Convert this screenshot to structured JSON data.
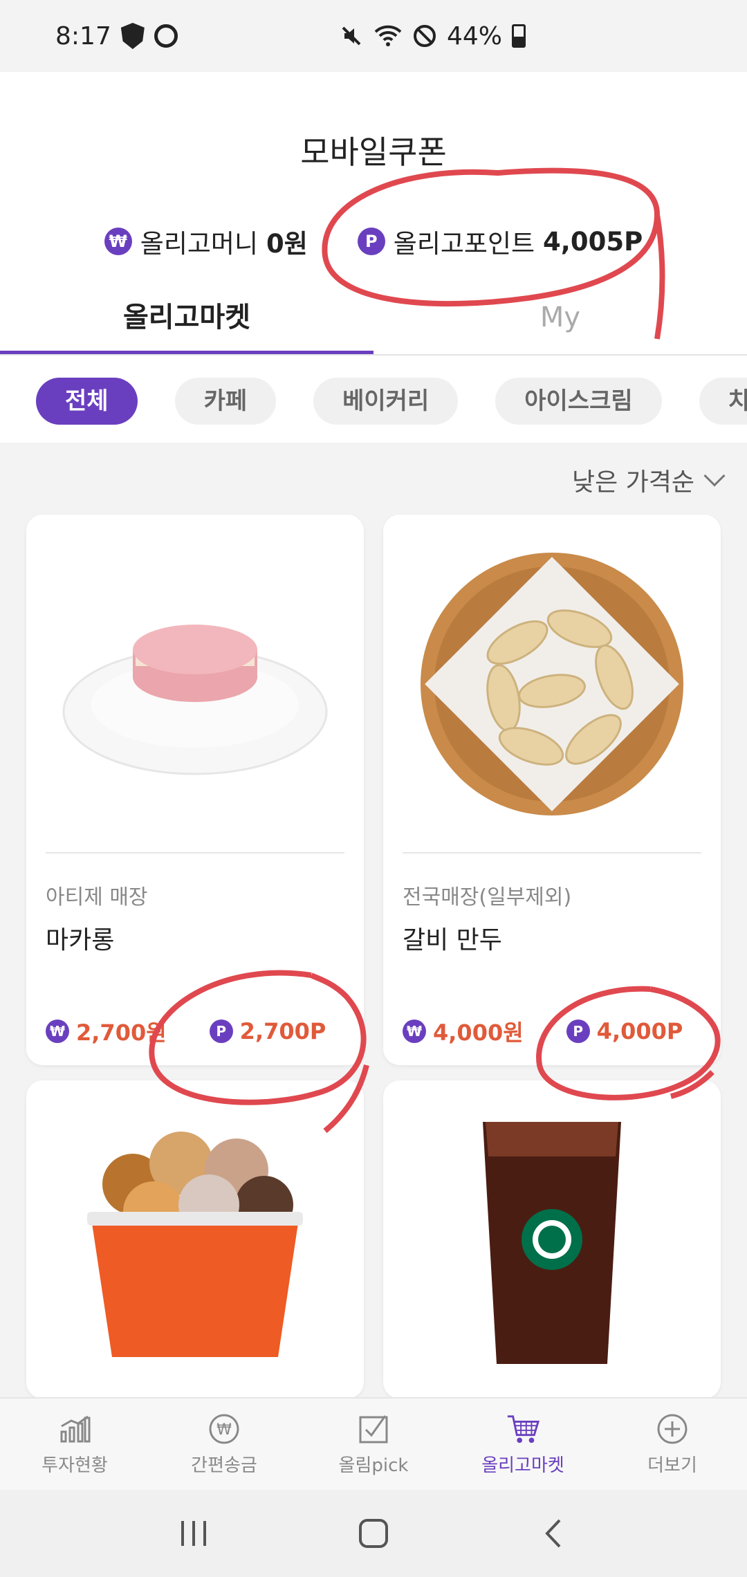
{
  "status_bar": {
    "time": "8:17",
    "battery": "44%"
  },
  "header": {
    "title": "모바일쿠폰",
    "money_label": "올리고머니",
    "money_value": "0원",
    "point_label": "올리고포인트",
    "point_value": "4,005P",
    "money_coin": "₩",
    "point_coin": "P"
  },
  "tabs": [
    {
      "label": "올리고마켓",
      "active": true
    },
    {
      "label": "My",
      "active": false
    }
  ],
  "chips": [
    "전체",
    "카페",
    "베이커리",
    "아이스크림",
    "치"
  ],
  "sort": {
    "label": "낮은 가격순"
  },
  "products": [
    {
      "store": "아티제 매장",
      "name": "마카롱",
      "price_won": "2,700원",
      "price_point": "2,700P"
    },
    {
      "store": "전국매장(일부제외)",
      "name": "갈비 만두",
      "price_won": "4,000원",
      "price_point": "4,000P"
    }
  ],
  "bottom_nav": [
    {
      "label": "투자현황",
      "icon": "chart-icon"
    },
    {
      "label": "간편송금",
      "icon": "won-icon"
    },
    {
      "label": "올림pick",
      "icon": "checkbox-icon"
    },
    {
      "label": "올리고마켓",
      "icon": "cart-icon",
      "active": true
    },
    {
      "label": "더보기",
      "icon": "plus-circle-icon"
    }
  ],
  "colors": {
    "accent": "#6a3fbf",
    "price": "#e05a3a",
    "annotation": "#e0484f"
  }
}
